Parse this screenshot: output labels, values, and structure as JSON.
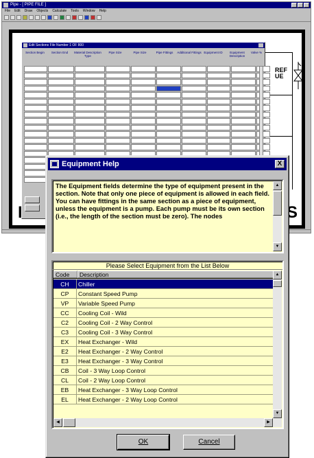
{
  "app": {
    "title": "Pipe - [ PIPE FILE ]",
    "menu": [
      "File",
      "Edit",
      "Draw",
      "Objects",
      "Calculate",
      "Tools",
      "Window",
      "Help"
    ]
  },
  "schematic": {
    "ref_label_line1": "REF",
    "ref_label_line2": "UE",
    "big_text_left": "H",
    "big_text_right": "S"
  },
  "editor": {
    "title": "Edit Sections  File Number 1 OF 800",
    "columns": [
      "Section Begin",
      "Section End",
      "Material Description Type",
      "Pipe Size",
      "Pipe Size",
      "Pipe Fittings",
      "Additional Fittings",
      "Equipment ID",
      "Equipment Description",
      "Valve %"
    ]
  },
  "dialog": {
    "title": "Equipment Help",
    "close_label": "X",
    "help_text": "The Equipment fields determine the type of equipment present in the section.  Note that only one piece of equipment is allowed in each field.  You can have fittings in the same section as a piece of equipment, unless the equipment is a pump.  Each pump must be its own section (i.e., the length of the section must be zero).  The nodes",
    "list_caption": "Please Select Equipment from the List Below",
    "col_code": "Code",
    "col_desc": "Description",
    "items": [
      {
        "code": "CH",
        "desc": "Chiller"
      },
      {
        "code": "CP",
        "desc": "Constant Speed Pump"
      },
      {
        "code": "VP",
        "desc": "Variable Speed Pump"
      },
      {
        "code": "CC",
        "desc": "Cooling Coil - Wild"
      },
      {
        "code": "C2",
        "desc": "Cooling Coil - 2 Way Control"
      },
      {
        "code": "C3",
        "desc": "Cooling Coil - 3 Way Control"
      },
      {
        "code": "EX",
        "desc": "Heat Exchanger - Wild"
      },
      {
        "code": "E2",
        "desc": "Heat Exchanger - 2 Way Control"
      },
      {
        "code": "E3",
        "desc": "Heat Exchanger - 3 Way Control"
      },
      {
        "code": "CB",
        "desc": "Coil - 3 Way Loop Control"
      },
      {
        "code": "CL",
        "desc": "Coil - 2 Way Loop Control"
      },
      {
        "code": "EB",
        "desc": "Heat Exchanger - 3 Way Loop Control"
      },
      {
        "code": "EL",
        "desc": "Heat Exchanger - 2 Way Loop Control"
      }
    ],
    "selected_index": 0,
    "ok_label": "OK",
    "cancel_label": "Cancel"
  }
}
